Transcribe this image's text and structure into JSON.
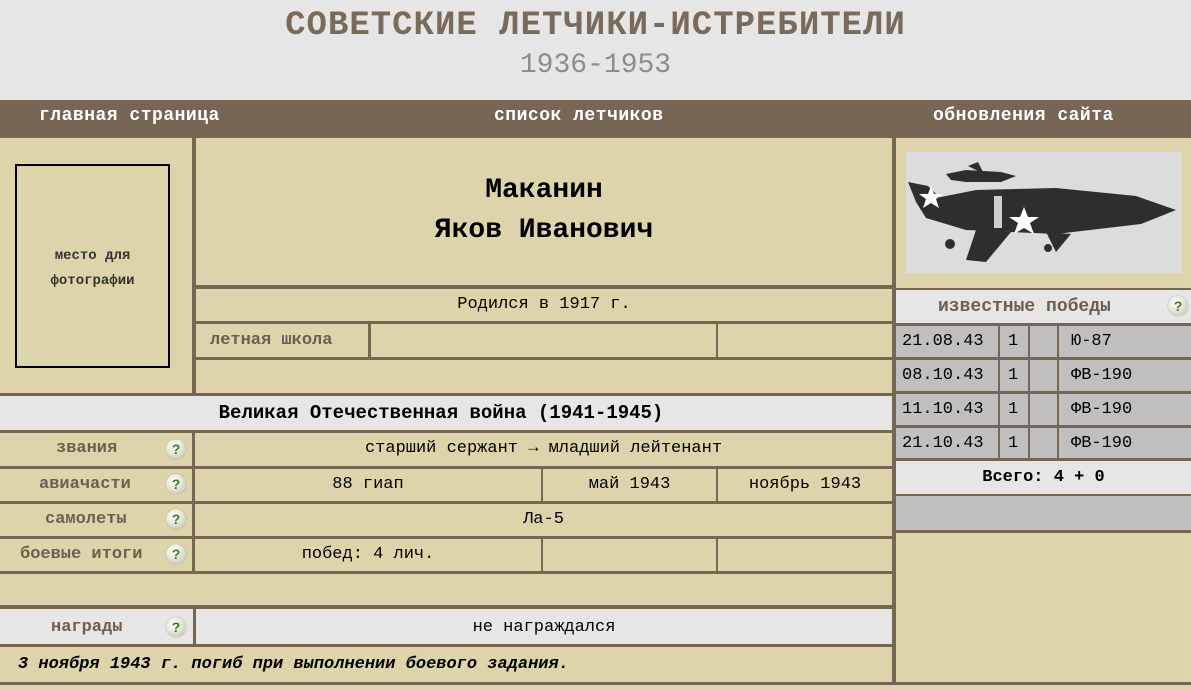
{
  "header": {
    "title": "СОВЕТСКИЕ ЛЕТЧИКИ-ИСТРЕБИТЕЛИ",
    "years": "1936-1953"
  },
  "nav": {
    "home": "главная страница",
    "pilots": "список летчиков",
    "updates": "обновления сайта"
  },
  "photo_placeholder": "место для фотографии",
  "pilot": {
    "surname": "Маканин",
    "given_names": "Яков Иванович",
    "born": "Родился в 1917 г.",
    "flight_school_label": "летная школа",
    "flight_school_value": "",
    "flight_school_extra": ""
  },
  "war": {
    "title": "Великая Отечественная война (1941-1945)",
    "ranks_label": "звания",
    "ranks_value": "старший сержант → младший лейтенант",
    "units_label": "авиачасти",
    "unit_name": "88 гиап",
    "unit_from": "май 1943",
    "unit_to": "ноябрь 1943",
    "planes_label": "самолеты",
    "planes_value": "Ла-5",
    "results_label": "боевые итоги",
    "results_value": "побед: 4 лич.",
    "awards_label": "награды",
    "awards_value": "не награждался",
    "fate": "3 ноября 1943 г. погиб при выполнении боевого задания."
  },
  "help_icon": "?",
  "victories": {
    "title": "известные победы",
    "rows": [
      {
        "date": "21.08.43",
        "count": "1",
        "shared": "",
        "type": "Ю-87"
      },
      {
        "date": "08.10.43",
        "count": "1",
        "shared": "",
        "type": "ФВ-190"
      },
      {
        "date": "11.10.43",
        "count": "1",
        "shared": "",
        "type": "ФВ-190"
      },
      {
        "date": "21.10.43",
        "count": "1",
        "shared": "",
        "type": "ФВ-190"
      }
    ],
    "total": "Всего: 4 + 0"
  },
  "colors": {
    "tan": "#ddd4ac",
    "brown": "#786654",
    "grey": "#e6e6e6",
    "title_brown": "#7a6a5a"
  }
}
